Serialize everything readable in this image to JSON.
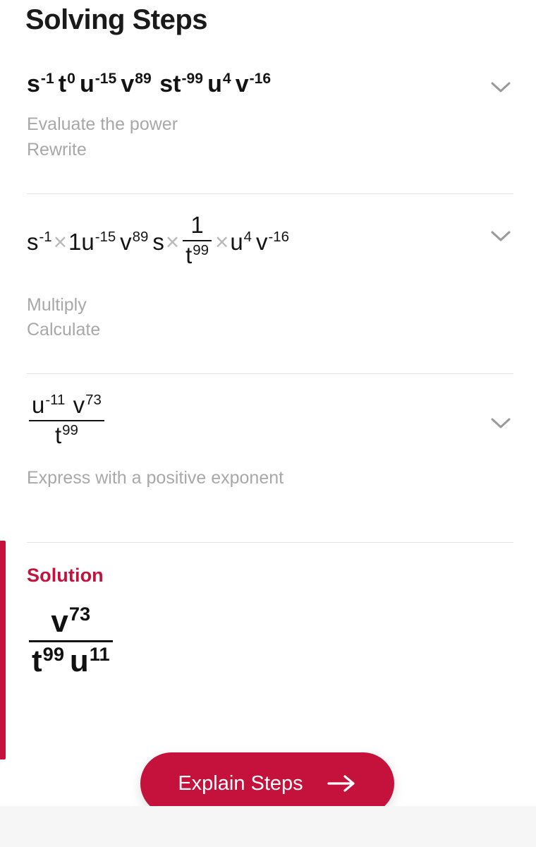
{
  "header": {
    "title": "Solving Steps"
  },
  "colors": {
    "brand_crimson": "#C4123C",
    "button_background": "#C4123C",
    "solution_bar": "#C4123C",
    "hint_text": "#A8A8A8",
    "divider": "#E3E3E3",
    "expression_text": "#141414",
    "times_symbol": "#B9B9B9"
  },
  "steps": [
    {
      "expression_plain": "s^-1 t^0 u^-15 v^89 s t^-99 u^4 v^-16",
      "tokens": [
        {
          "base": "s",
          "exp": "-1"
        },
        {
          "base": "t",
          "exp": "0"
        },
        {
          "base": "u",
          "exp": "-15"
        },
        {
          "base": "v",
          "exp": "89"
        },
        {
          "base": "s",
          "exp": ""
        },
        {
          "base": "t",
          "exp": "-99"
        },
        {
          "base": "u",
          "exp": "4"
        },
        {
          "base": "v",
          "exp": "-16"
        }
      ],
      "hints": [
        "Evaluate the power",
        "Rewrite"
      ],
      "toggle_icon": "chevron-down-icon"
    },
    {
      "expression_plain": "s^-1 × 1 u^-15 v^89 s × 1/t^99 × u^4 v^-16",
      "hints": [
        "Multiply",
        "Calculate"
      ],
      "toggle_icon": "chevron-down-icon",
      "parts": {
        "s_exp": "-1",
        "one": "1",
        "u_exp": "-15",
        "v_exp": "89",
        "s_plain": "s",
        "frac_numerator": "1",
        "frac_denominator_base": "t",
        "frac_denominator_exp": "99",
        "u2_exp": "4",
        "v2_exp": "-16",
        "times_symbol": "×"
      }
    },
    {
      "expression_plain": "(u^-11 v^73) / t^99",
      "hints": [
        "Express with a positive exponent"
      ],
      "toggle_icon": "chevron-down-icon",
      "fraction": {
        "numerator": [
          {
            "base": "u",
            "exp": "-11"
          },
          {
            "base": "v",
            "exp": "73"
          }
        ],
        "denominator": [
          {
            "base": "t",
            "exp": "99"
          }
        ]
      }
    }
  ],
  "solution": {
    "label": "Solution",
    "expression_plain": "v^73 / (t^99 u^11)",
    "fraction": {
      "numerator": [
        {
          "base": "v",
          "exp": "73"
        }
      ],
      "denominator": [
        {
          "base": "t",
          "exp": "99"
        },
        {
          "base": "u",
          "exp": "11"
        }
      ]
    }
  },
  "cta": {
    "label": "Explain Steps",
    "icon": "arrow-right-icon"
  }
}
